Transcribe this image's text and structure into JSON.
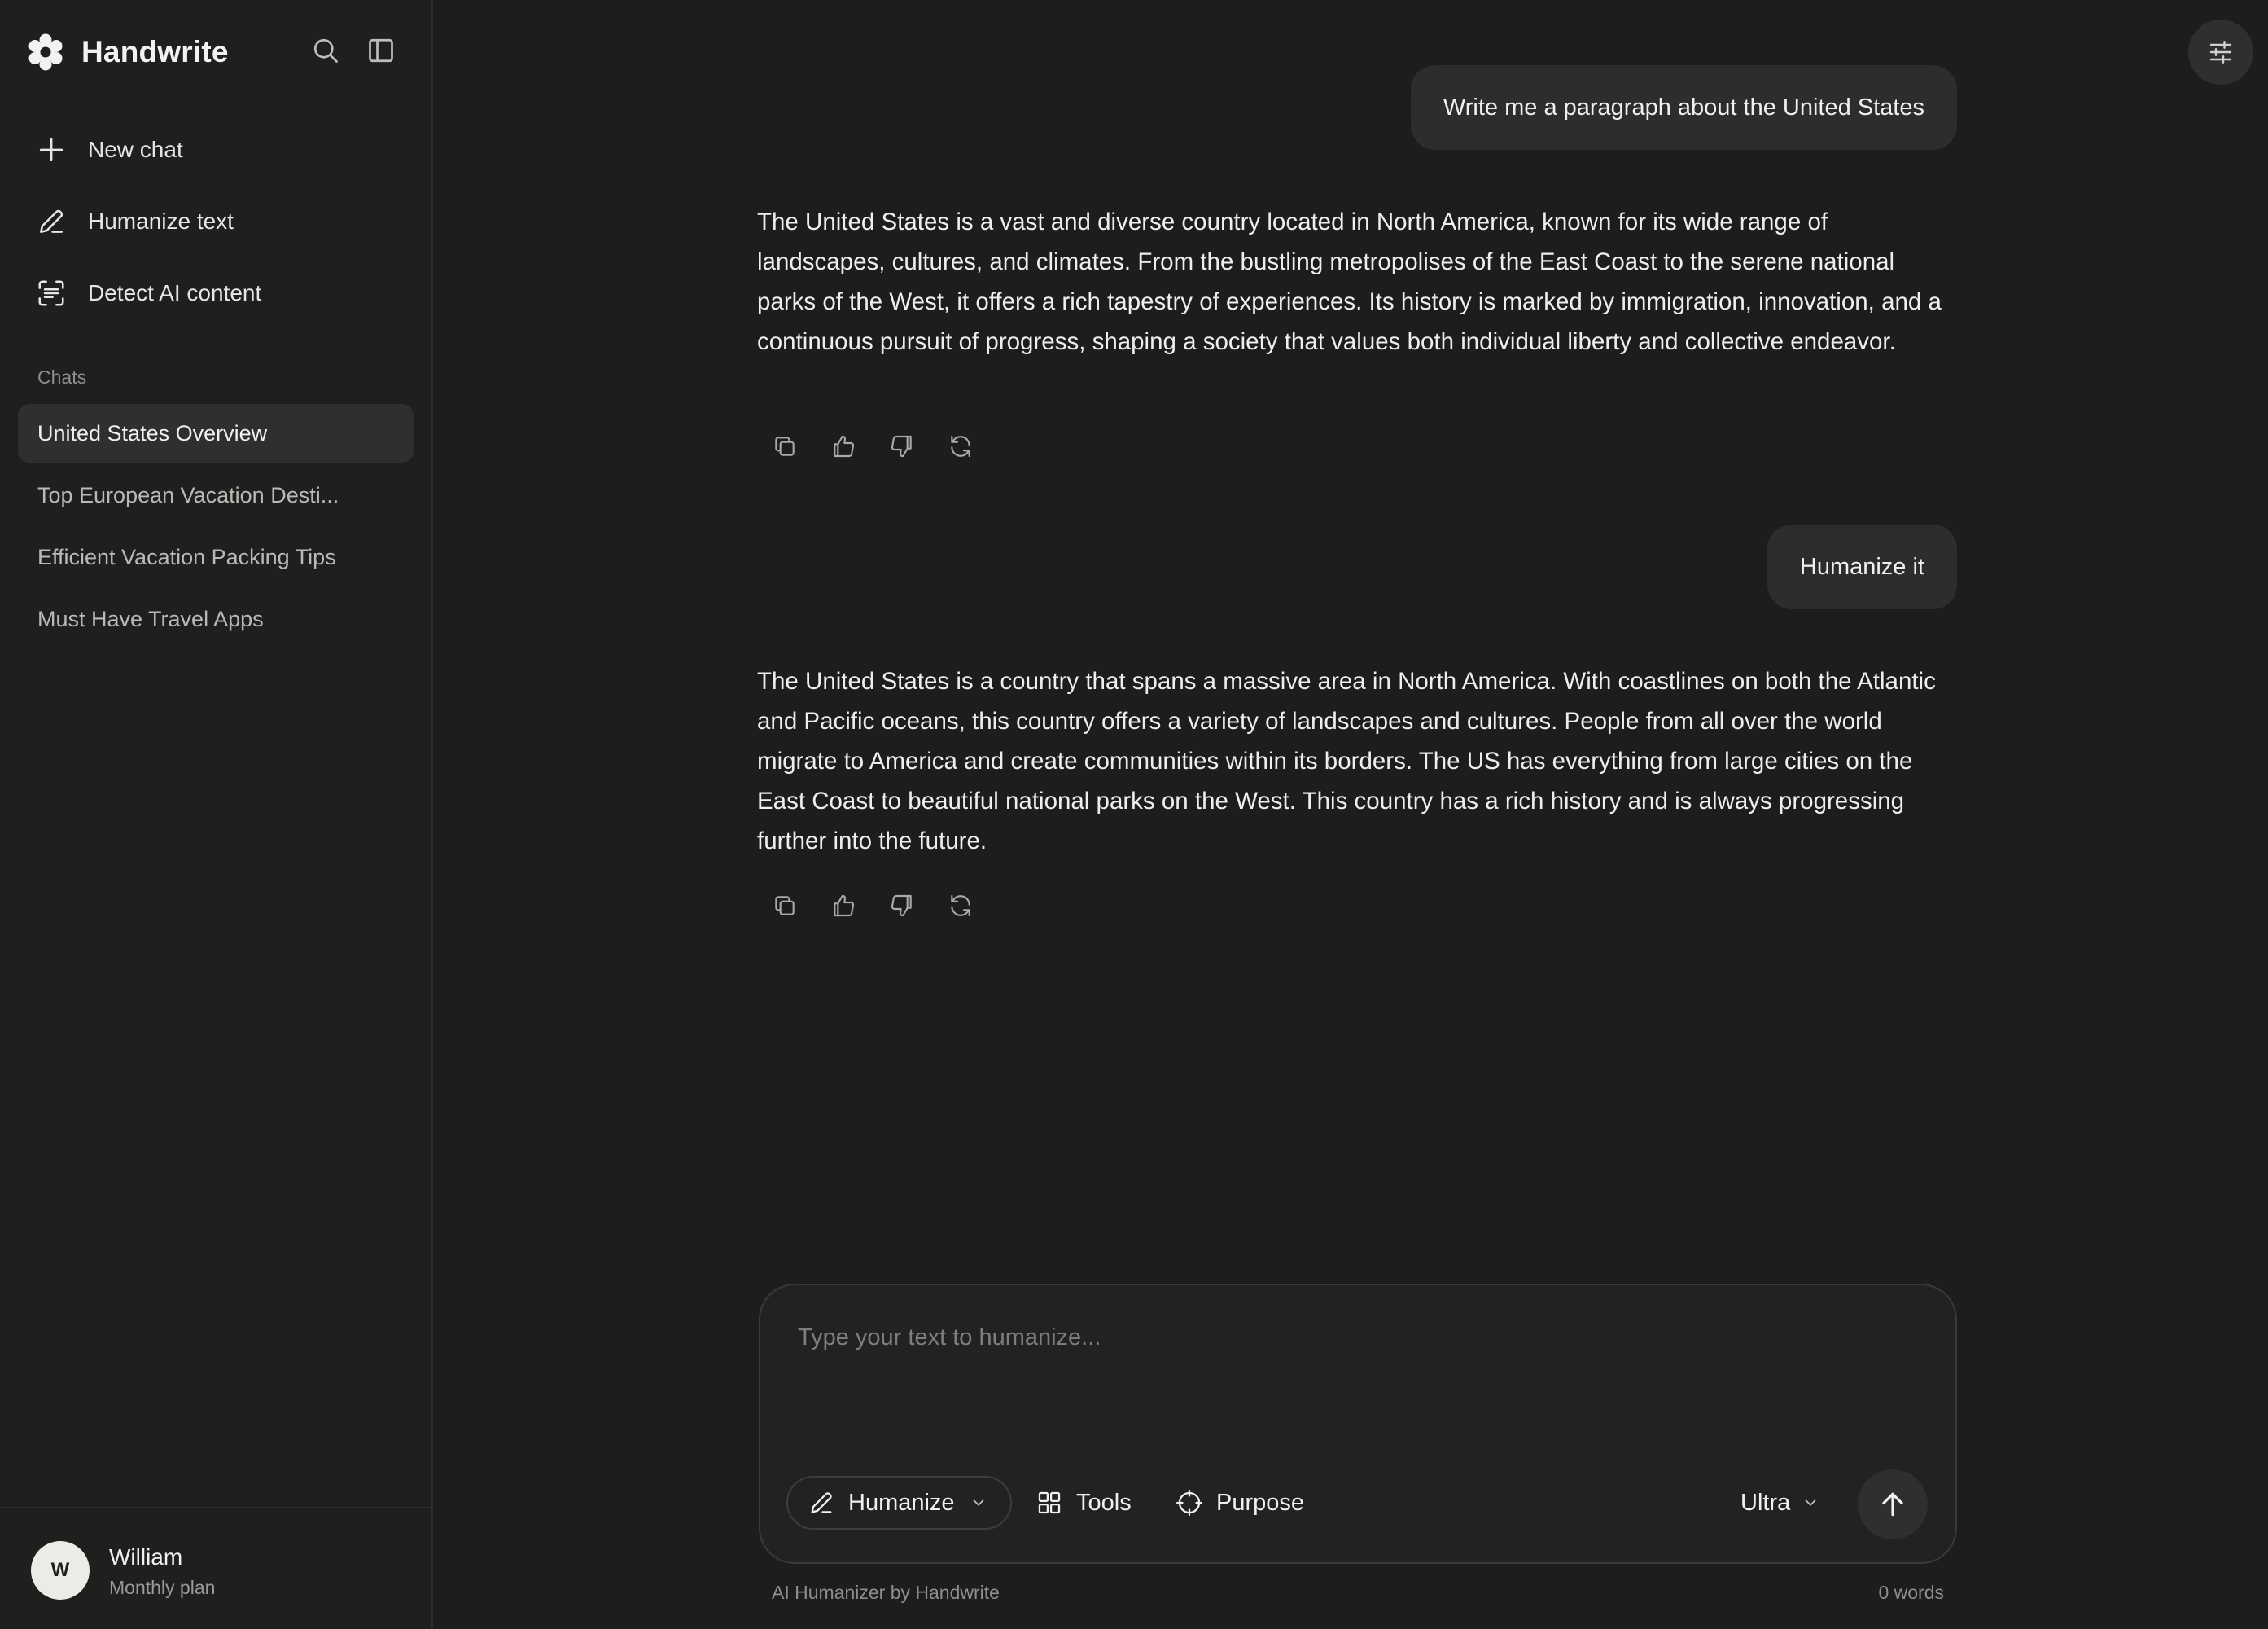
{
  "app": {
    "name": "Handwrite",
    "logo_icon": "flower-logo-icon"
  },
  "sidebar": {
    "search_icon": "search-icon",
    "toggle_icon": "sidebar-toggle-icon",
    "nav": [
      {
        "label": "New chat",
        "icon": "plus-icon"
      },
      {
        "label": "Humanize text",
        "icon": "pencil-icon"
      },
      {
        "label": "Detect AI content",
        "icon": "scan-text-icon"
      }
    ],
    "chats_label": "Chats",
    "chats": [
      {
        "label": "United States Overview",
        "active": true
      },
      {
        "label": "Top European Vacation Desti...",
        "active": false
      },
      {
        "label": "Efficient Vacation Packing Tips",
        "active": false
      },
      {
        "label": "Must Have Travel Apps",
        "active": false
      }
    ],
    "user": {
      "initial": "W",
      "name": "William",
      "plan": "Monthly plan"
    }
  },
  "conversation": {
    "messages": [
      {
        "role": "user",
        "text": "Write me a paragraph about the United States"
      },
      {
        "role": "assistant",
        "text": "The United States is a vast and diverse country located in North America, known for its wide range of landscapes, cultures, and climates. From the bustling metropolises of the East Coast to the serene national parks of the West, it offers a rich tapestry of experiences. Its history is marked by immigration, innovation, and a continuous pursuit of progress, shaping a society that values both individual liberty and collective endeavor."
      },
      {
        "role": "user",
        "text": "Humanize it"
      },
      {
        "role": "assistant",
        "text": "The United States is a country that spans a massive area in North America. With coastlines on both the Atlantic and Pacific oceans, this country offers a variety of landscapes and cultures. People from all over the world migrate to America and create communities within its borders. The US has everything from large cities on the East Coast to beautiful national parks on the West. This country has a rich history and is always progressing further into the future."
      }
    ],
    "message_actions": [
      "copy-icon",
      "thumbs-up-icon",
      "thumbs-down-icon",
      "regenerate-icon"
    ]
  },
  "composer": {
    "value": "",
    "placeholder": "Type your text to humanize...",
    "mode_label": "Humanize",
    "tools_label": "Tools",
    "purpose_label": "Purpose",
    "model_label": "Ultra",
    "footer_left": "AI Humanizer by Handwrite",
    "word_count": "0 words"
  },
  "colors": {
    "background": "#1d1d1c",
    "sidebar": "#1f1f1e",
    "bubble": "#2d2d2c",
    "text": "#eeeeee",
    "muted": "#8e8e8c"
  }
}
